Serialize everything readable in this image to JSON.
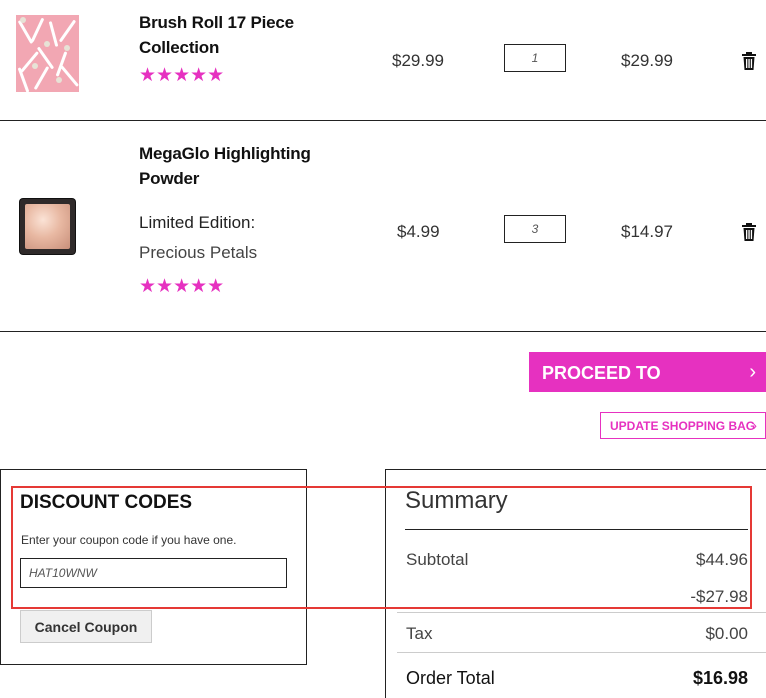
{
  "cart": {
    "items": [
      {
        "name_line1": "Brush Roll 17 Piece",
        "name_line2": "Collection",
        "rating_stars": "★★★★★",
        "rating": 5,
        "price": "$29.99",
        "quantity": "1",
        "subtotal": "$29.99",
        "image_icon": "brush-roll-product-image"
      },
      {
        "name_line1": "MegaGlo Highlighting",
        "name_line2": "Powder",
        "option_label": "Limited Edition:",
        "option_value": "Precious Petals",
        "rating_stars": "★★★★★",
        "rating": 5,
        "price": "$4.99",
        "quantity": "3",
        "subtotal": "$14.97",
        "image_icon": "highlighter-powder-product-image"
      }
    ],
    "delete_icon": "trash-icon"
  },
  "actions": {
    "checkout_label": "PROCEED TO CHECKOUT",
    "checkout_chevron": "›",
    "update_label": "UPDATE SHOPPING BAG",
    "update_chevron": "›"
  },
  "discount": {
    "title": "DISCOUNT CODES",
    "help_text": "Enter your coupon code if you have one.",
    "coupon_value": "HAT10WNW",
    "cancel_label": "Cancel Coupon"
  },
  "summary": {
    "title": "Summary",
    "subtotal_label": "Subtotal",
    "subtotal_value": "$44.96",
    "discount_value": "-$27.98",
    "tax_label": "Tax",
    "tax_value": "$0.00",
    "total_label": "Order Total",
    "total_value": "$16.98"
  },
  "colors": {
    "accent": "#e631c0",
    "highlight": "#e53935"
  }
}
